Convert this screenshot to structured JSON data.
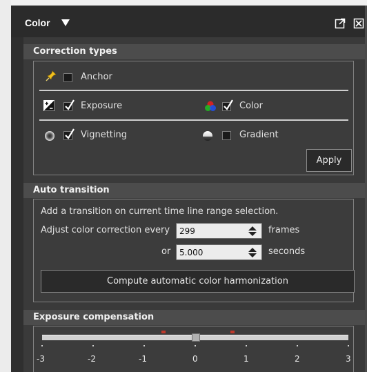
{
  "panel": {
    "title": "Color",
    "title_menu_icon": "triangle-down-icon",
    "popout_icon": "popout-icon",
    "close_icon": "close-icon"
  },
  "correction_types": {
    "header": "Correction types",
    "anchor": {
      "label": "Anchor",
      "checked": false,
      "icon": "pin-icon"
    },
    "exposure": {
      "label": "Exposure",
      "checked": true,
      "icon": "exposure-plusminus-icon"
    },
    "color": {
      "label": "Color",
      "checked": true,
      "icon": "rgb-circles-icon"
    },
    "vignetting": {
      "label": "Vignetting",
      "checked": true,
      "icon": "vignette-circle-icon"
    },
    "gradient": {
      "label": "Gradient",
      "checked": false,
      "icon": "gradient-circle-icon"
    },
    "apply_label": "Apply"
  },
  "auto_transition": {
    "header": "Auto transition",
    "description": "Add a transition on current time line range selection.",
    "adjust_label": "Adjust color correction every",
    "frames_value": "299",
    "frames_unit": "frames",
    "or_label": "or",
    "seconds_value": "5.000",
    "seconds_unit": "seconds",
    "compute_label": "Compute automatic color harmonization"
  },
  "exposure_compensation": {
    "header": "Exposure compensation",
    "ticks": [
      "-3",
      "-2",
      "-1",
      "0",
      "1",
      "2",
      "3"
    ],
    "value": 0
  },
  "colors": {
    "panel_bg": "#2f2f2f",
    "section_header_bg": "#4c4c4c",
    "box_bg": "#3c3c3c",
    "marker_red": "#c0392b"
  }
}
